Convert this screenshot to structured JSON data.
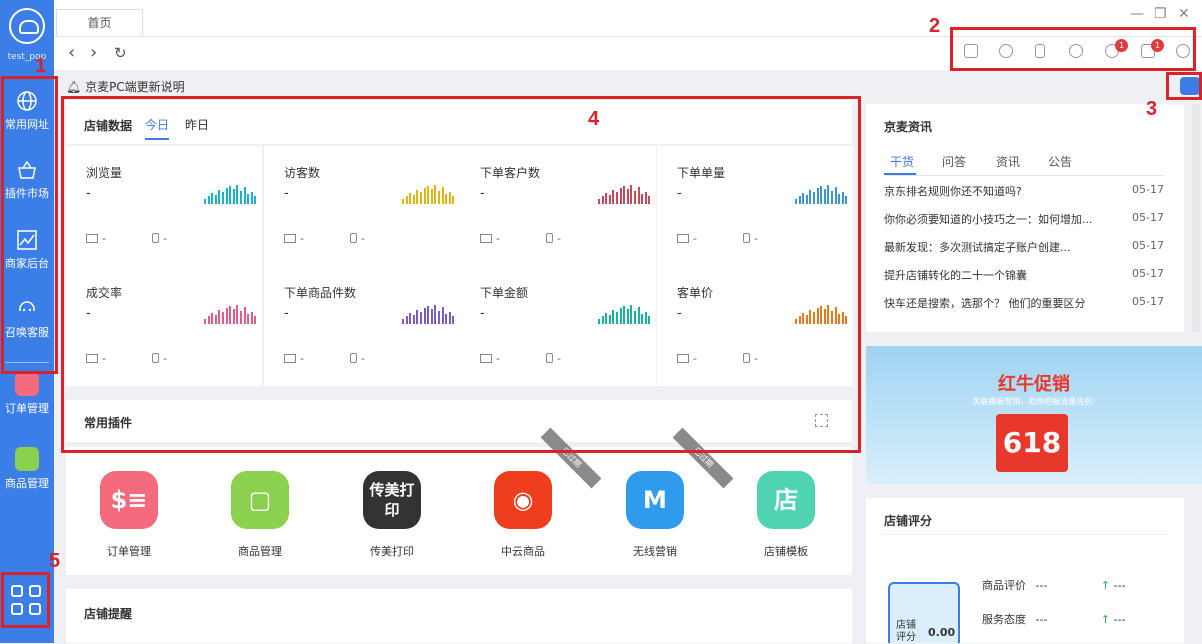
{
  "sidebar": {
    "account": "test_pop",
    "items": [
      {
        "label": "常用网址",
        "icon": "globe-icon"
      },
      {
        "label": "插件市场",
        "icon": "basket-icon"
      },
      {
        "label": "商家后台",
        "icon": "chart-icon"
      },
      {
        "label": "召唤客服",
        "icon": "headset-icon"
      },
      {
        "label": "订单管理",
        "icon": "order-app-icon"
      },
      {
        "label": "商品管理",
        "icon": "product-app-icon"
      }
    ]
  },
  "tabs": [
    {
      "label": "首页"
    }
  ],
  "notice": "京麦PC端更新说明",
  "toolbar": {
    "badge_plugin": "1",
    "badge_message": "1"
  },
  "shop_data": {
    "title": "店铺数据",
    "tabs": [
      "今日",
      "昨日"
    ],
    "metrics": [
      {
        "label": "浏览量",
        "value": "-",
        "pc": "-",
        "mobile": "-",
        "color": "#19b3c9"
      },
      {
        "label": "访客数",
        "value": "-",
        "pc": "-",
        "mobile": "-",
        "color": "#e2b418"
      },
      {
        "label": "下单客户数",
        "value": "-",
        "pc": "-",
        "mobile": "-",
        "color": "#c84a5a"
      },
      {
        "label": "下单单量",
        "value": "-",
        "pc": "-",
        "mobile": "-",
        "color": "#3a94d8"
      },
      {
        "label": "成交率",
        "value": "-",
        "pc": "-",
        "mobile": "-",
        "color": "#e45a8a"
      },
      {
        "label": "下单商品件数",
        "value": "-",
        "pc": "-",
        "mobile": "-",
        "color": "#7b5cc4"
      },
      {
        "label": "下单金额",
        "value": "-",
        "pc": "-",
        "mobile": "-",
        "color": "#17b39a"
      },
      {
        "label": "客单价",
        "value": "-",
        "pc": "-",
        "mobile": "-",
        "color": "#e8781c"
      }
    ]
  },
  "plugins": {
    "title": "常用插件",
    "items": [
      {
        "label": "订单管理",
        "color": "#f36b7d",
        "glyph": "$≡"
      },
      {
        "label": "商品管理",
        "color": "#8bd14f",
        "glyph": "▢"
      },
      {
        "label": "传美打印",
        "color": "#333333",
        "glyph": "传美打印"
      },
      {
        "label": "中云商品",
        "color": "#ee3e1d",
        "glyph": "◉"
      },
      {
        "label": "无线营销",
        "color": "#2f9bec",
        "glyph": "M"
      },
      {
        "label": "店铺模板",
        "color": "#4fd3b0",
        "glyph": "店"
      }
    ],
    "ribbon_label": "已过期"
  },
  "reminder": {
    "title": "店铺提醒"
  },
  "news": {
    "title": "京麦资讯",
    "tabs": [
      "干货",
      "问答",
      "资讯",
      "公告"
    ],
    "rows": [
      {
        "title": "京东排名规则你还不知道吗?",
        "date": "05-17"
      },
      {
        "title": "你你必须要知道的小技巧之一：如何增加...",
        "date": "05-17"
      },
      {
        "title": "最新发现：多次测试搞定子账户创建...",
        "date": "05-17"
      },
      {
        "title": "提升店铺转化的二十一个锦囊",
        "date": "05-17"
      },
      {
        "title": "快车还是搜索，选那个？ 他们的重要区分",
        "date": "05-17"
      }
    ]
  },
  "banner": {
    "title": "红牛促销",
    "subtitle": "关联模板营销，助你把握流量先机!",
    "number": "618"
  },
  "rating": {
    "title": "店铺评分",
    "shop_label": "店铺评分",
    "shop_value": "0.00",
    "rows": [
      {
        "label": "商品评价",
        "value": "---",
        "trend": "---"
      },
      {
        "label": "服务态度",
        "value": "---",
        "trend": "---"
      }
    ]
  },
  "annotations": [
    "1",
    "2",
    "3",
    "4",
    "5"
  ]
}
